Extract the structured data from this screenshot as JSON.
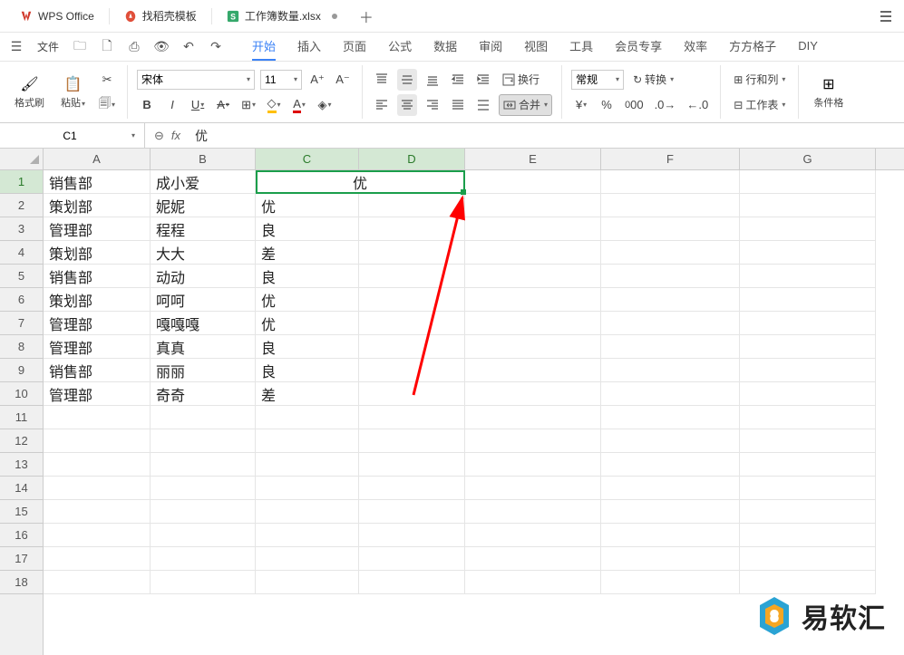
{
  "titlebar": {
    "app_name": "WPS Office",
    "tab1": "找稻壳模板",
    "tab2": "工作簿数量.xlsx"
  },
  "quick": {
    "file": "文件"
  },
  "menu": {
    "start": "开始",
    "insert": "插入",
    "page": "页面",
    "formula": "公式",
    "data": "数据",
    "review": "审阅",
    "view": "视图",
    "tools": "工具",
    "member": "会员专享",
    "efficiency": "效率",
    "grid": "方方格子",
    "diy": "DIY"
  },
  "ribbon": {
    "format_painter": "格式刷",
    "paste": "粘贴",
    "font_name": "宋体",
    "font_size": "11",
    "wrap": "换行",
    "merge": "合并",
    "general": "常规",
    "convert": "转换",
    "rowcol": "行和列",
    "sheet": "工作表",
    "condfmt": "条件格"
  },
  "formulabar": {
    "cellref": "C1",
    "fx": "fx",
    "value": "优"
  },
  "cols": [
    "A",
    "B",
    "C",
    "D",
    "E",
    "F",
    "G"
  ],
  "rows": [
    "1",
    "2",
    "3",
    "4",
    "5",
    "6",
    "7",
    "8",
    "9",
    "10",
    "11",
    "12",
    "13",
    "14",
    "15",
    "16",
    "17",
    "18"
  ],
  "data_rows": [
    {
      "a": "销售部",
      "b": "成小爱",
      "c": "优",
      "merged": true
    },
    {
      "a": "策划部",
      "b": "妮妮",
      "c": "优"
    },
    {
      "a": "管理部",
      "b": "程程",
      "c": "良"
    },
    {
      "a": "策划部",
      "b": "大大",
      "c": "差"
    },
    {
      "a": "销售部",
      "b": "动动",
      "c": "良"
    },
    {
      "a": "策划部",
      "b": "呵呵",
      "c": "优"
    },
    {
      "a": "管理部",
      "b": "嘎嘎嘎",
      "c": "优"
    },
    {
      "a": "管理部",
      "b": "真真",
      "c": "良"
    },
    {
      "a": "销售部",
      "b": "丽丽",
      "c": "良"
    },
    {
      "a": "管理部",
      "b": "奇奇",
      "c": "差"
    }
  ],
  "watermark": {
    "text": "易软汇"
  }
}
